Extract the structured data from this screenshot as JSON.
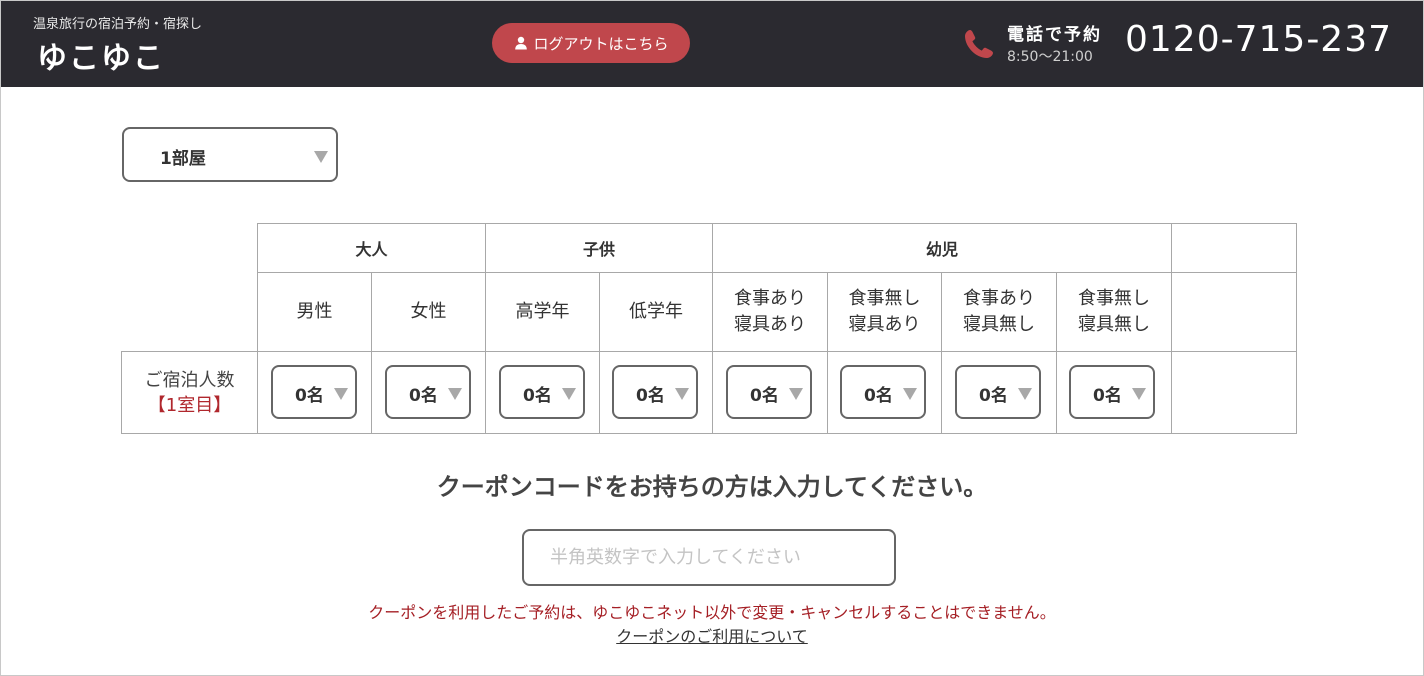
{
  "header": {
    "tagline": "温泉旅行の宿泊予約・宿探し",
    "logo": "ゆこゆこ",
    "logout_label": "ログアウトはこちら",
    "phone_label": "電話で予約",
    "phone_hours": "8:50～21:00",
    "phone_number": "0120-715-237",
    "accent_color": "#c0474c",
    "phone_icon_color": "#c0474c",
    "background_color": "#2b2a30"
  },
  "room_select": {
    "value": "1部屋"
  },
  "guest_table": {
    "groups": [
      "大人",
      "子供",
      "幼児"
    ],
    "columns": [
      "男性",
      "女性",
      "高学年",
      "低学年",
      "食事あり\n寝具あり",
      "食事無し\n寝具あり",
      "食事あり\n寝具無し",
      "食事無し\n寝具無し"
    ],
    "row_label": "ご宿泊人数",
    "row_room": "【1室目】",
    "counts": [
      "0名",
      "0名",
      "0名",
      "0名",
      "0名",
      "0名",
      "0名",
      "0名"
    ]
  },
  "coupon": {
    "title": "クーポンコードをお持ちの方は入力してください。",
    "placeholder": "半角英数字で入力してください",
    "value": "",
    "note": "クーポンを利用したご予約は、ゆこゆこネット以外で変更・キャンセルすることはできません。",
    "link_label": "クーポンのご利用について"
  }
}
